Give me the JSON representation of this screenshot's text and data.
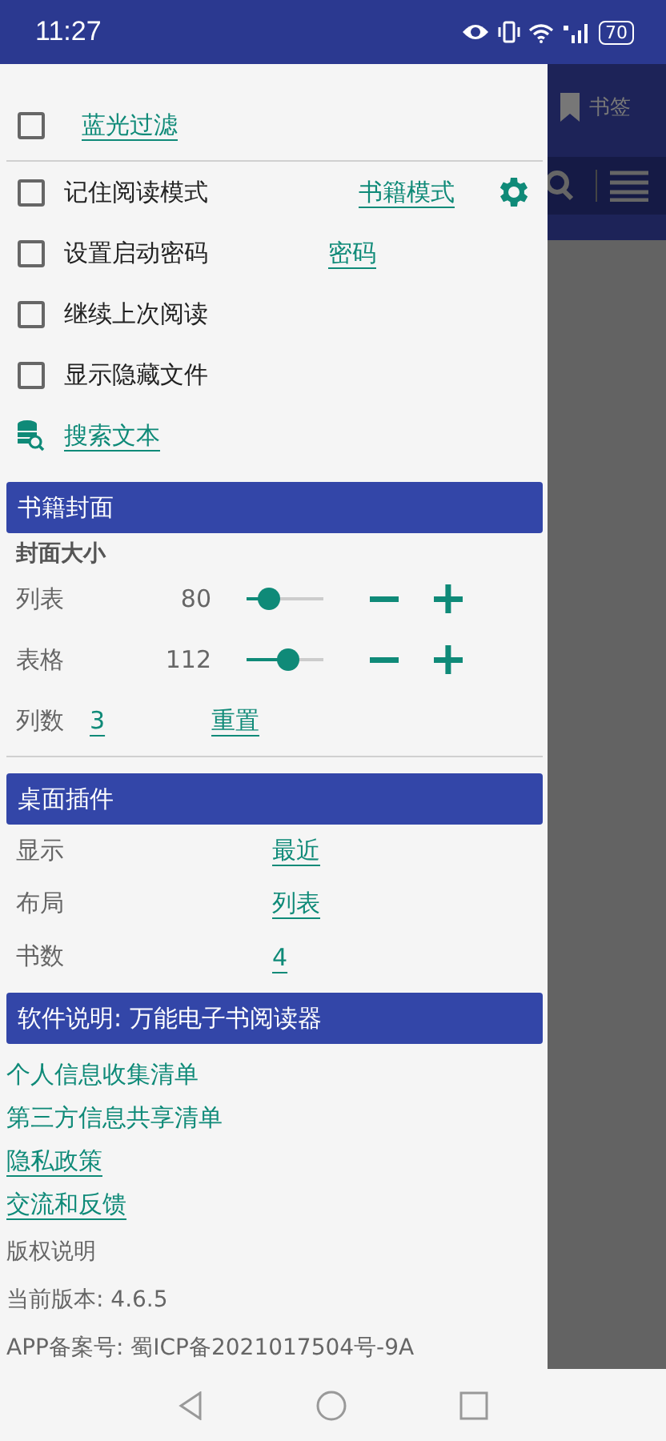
{
  "status_bar": {
    "time": "11:27",
    "battery": "70"
  },
  "blue_light_filter": {
    "checked": false,
    "label": "蓝光过滤"
  },
  "options": [
    {
      "kind": "gear",
      "checked": false,
      "label": "记住阅读模式",
      "link": "书籍模式"
    },
    {
      "kind": "link",
      "checked": false,
      "label": "设置启动密码",
      "link": "密码"
    },
    {
      "kind": "plain",
      "checked": false,
      "label": "继续上次阅读"
    },
    {
      "kind": "plain",
      "checked": false,
      "label": "显示隐藏文件"
    }
  ],
  "search_text": "搜索文本",
  "cover_section": {
    "title": "书籍封面",
    "subtitle": "封面大小",
    "sliders": [
      {
        "label": "列表",
        "value": "80",
        "level": 0.3
      },
      {
        "label": "表格",
        "value": "112",
        "level": 0.55
      }
    ],
    "columns_label": "列数",
    "columns_value": "3",
    "reset": "重置"
  },
  "widget_section": {
    "title": "桌面插件",
    "rows": [
      {
        "label": "显示",
        "value": "最近"
      },
      {
        "label": "布局",
        "value": "列表"
      },
      {
        "label": "书数",
        "value": "4"
      }
    ]
  },
  "about_section": {
    "title": "软件说明: 万能电子书阅读器",
    "links": [
      {
        "text": "个人信息收集清单",
        "underlined": false
      },
      {
        "text": "第三方信息共享清单",
        "underlined": false
      },
      {
        "text": "隐私政策",
        "underlined": true
      },
      {
        "text": "交流和反馈",
        "underlined": true
      }
    ],
    "info": [
      "版权说明",
      "当前版本: 4.6.5",
      "APP备案号:  蜀ICP备2021017504号-9A"
    ]
  },
  "background_app": {
    "bookmark": "书签"
  }
}
